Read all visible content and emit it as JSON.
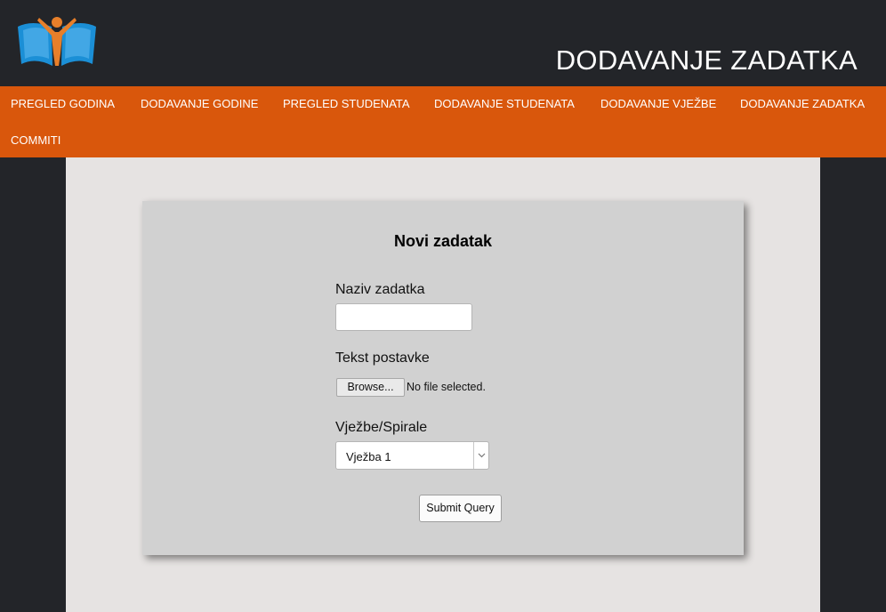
{
  "header": {
    "page_title": "DODAVANJE ZADATKA",
    "logo_icon": "book-with-person-logo-icon"
  },
  "nav": {
    "items": [
      {
        "label": "PREGLED GODINA"
      },
      {
        "label": "DODAVANJE GODINE"
      },
      {
        "label": "PREGLED STUDENATA"
      },
      {
        "label": "DODAVANJE STUDENATA"
      },
      {
        "label": "DODAVANJE VJEŽBE"
      },
      {
        "label": "DODAVANJE ZADATKA"
      },
      {
        "label": "COMMITI"
      }
    ]
  },
  "form": {
    "title": "Novi zadatak",
    "name_label": "Naziv zadatka",
    "name_value": "",
    "text_label": "Tekst postavke",
    "browse_label": "Browse...",
    "file_status": "No file selected.",
    "exercise_label": "Vježbe/Spirale",
    "exercise_selected": "Vježba 1",
    "submit_label": "Submit Query"
  },
  "colors": {
    "background": "#232529",
    "nav": "#d9570c",
    "content": "#e6e3e2",
    "card": "#d1d1d1",
    "logo_blue": "#1b8fd6",
    "logo_orange": "#e77f2a"
  }
}
